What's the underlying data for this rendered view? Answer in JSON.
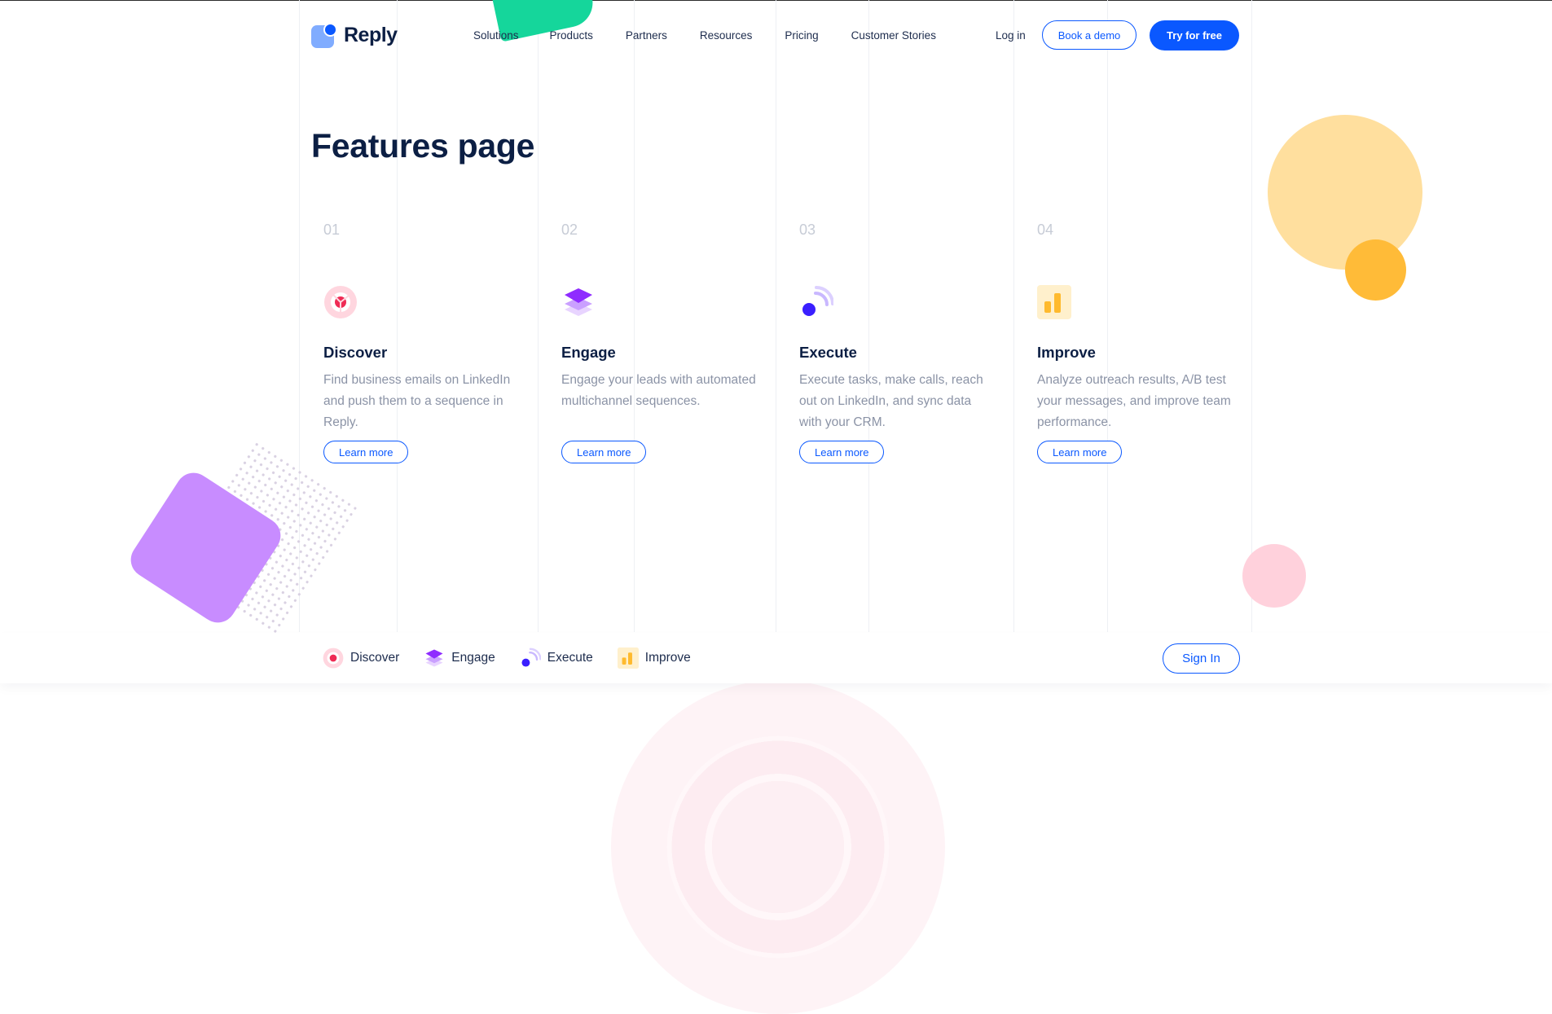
{
  "brand": {
    "name": "Reply",
    "primary_color": "#0a58ff",
    "logo_icon": "reply-logo-icon"
  },
  "nav": {
    "items": [
      "Solutions",
      "Products",
      "Partners",
      "Resources",
      "Pricing",
      "Customer Stories"
    ],
    "login": "Log in",
    "book_demo": "Book a demo",
    "try_free": "Try for free"
  },
  "page": {
    "title": "Features page"
  },
  "features": [
    {
      "num": "01",
      "name": "Discover",
      "icon": "discover-icon",
      "desc": "Find business emails on LinkedIn and push them to a sequence in Reply.",
      "cta": "Learn more"
    },
    {
      "num": "02",
      "name": "Engage",
      "icon": "engage-icon",
      "desc": "Engage your leads with automated multichannel sequences.",
      "cta": "Learn more"
    },
    {
      "num": "03",
      "name": "Execute",
      "icon": "execute-icon",
      "desc": "Execute tasks, make calls, reach out on LinkedIn, and sync data with your CRM.",
      "cta": "Learn more"
    },
    {
      "num": "04",
      "name": "Improve",
      "icon": "improve-icon",
      "desc": "Analyze outreach results, A/B test your messages, and improve team performance.",
      "cta": "Learn more"
    }
  ],
  "sticky_bar": {
    "items": [
      "Discover",
      "Engage",
      "Execute",
      "Improve"
    ],
    "sign_in": "Sign In"
  }
}
